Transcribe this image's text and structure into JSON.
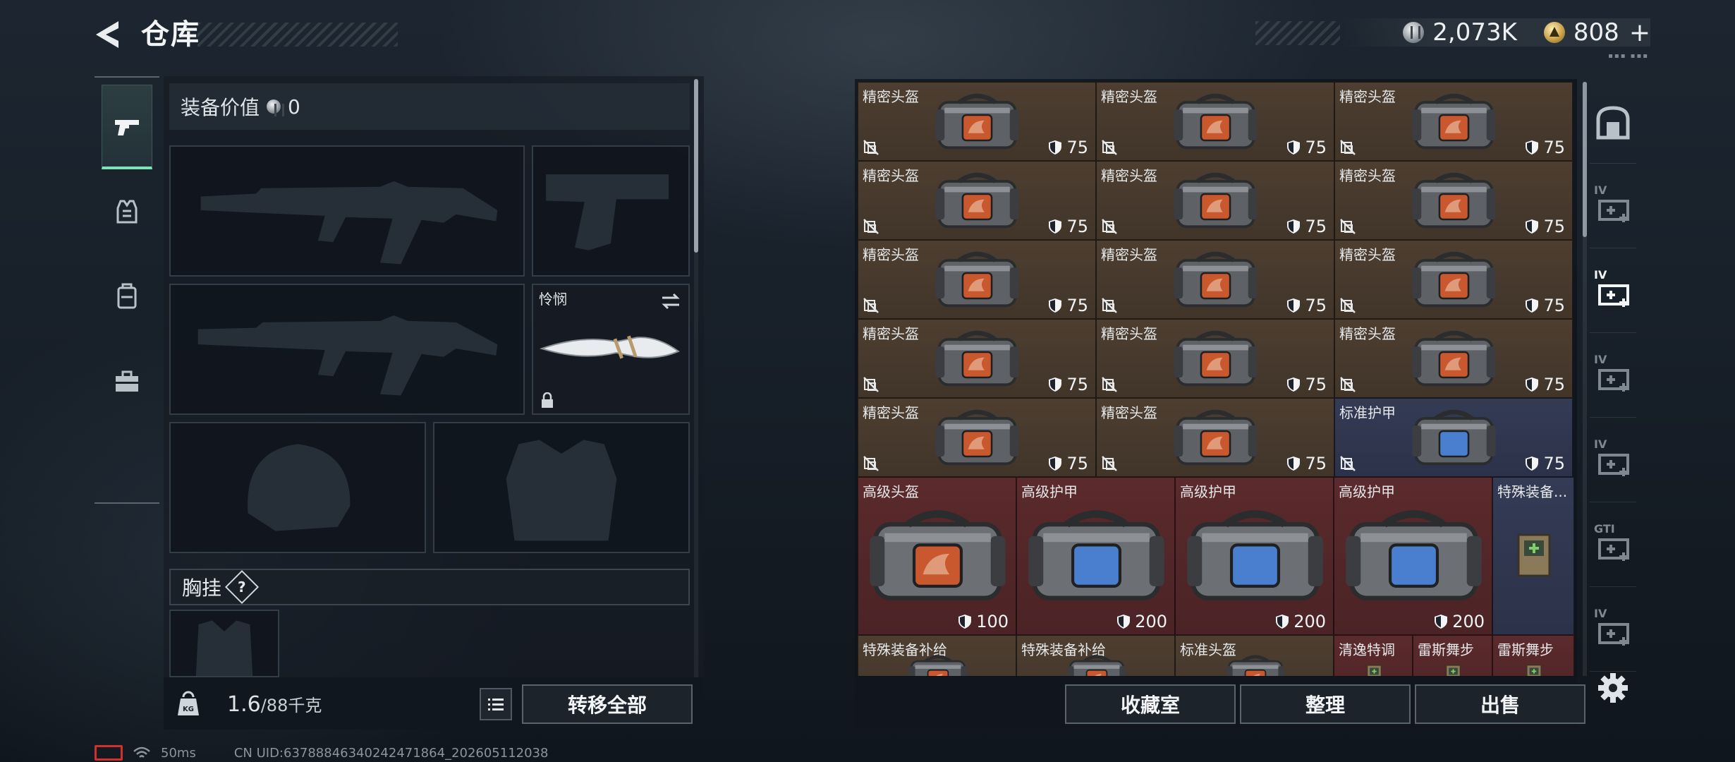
{
  "header": {
    "title": "仓库",
    "back_icon": "back-arrow-icon"
  },
  "currency": {
    "silver_amount": "2,073K",
    "silver_icon": "silver-coin-icon",
    "gold_amount": "808",
    "gold_icon": "gold-coin-icon",
    "plus_label": "+"
  },
  "rail": {
    "items": [
      {
        "icon": "pistol-icon",
        "active": true
      },
      {
        "icon": "armor-vest-icon",
        "active": false
      },
      {
        "icon": "backpack-icon",
        "active": false
      },
      {
        "icon": "toolbox-icon",
        "active": false
      }
    ]
  },
  "equipment": {
    "value_label": "装备价值",
    "value_amount": "0",
    "melee_name": "怜悯",
    "chest_label": "胸挂",
    "help_label": "?",
    "weight_current": "1.6",
    "weight_max": "/88千克",
    "transfer_all": "转移全部"
  },
  "storage": {
    "rows": [
      [
        {
          "name": "精密头盔",
          "color": "brown",
          "armor": "75",
          "locked": true
        },
        {
          "name": "精密头盔",
          "color": "brown",
          "armor": "75",
          "locked": true
        },
        {
          "name": "精密头盔",
          "color": "brown",
          "armor": "75",
          "locked": true
        }
      ],
      [
        {
          "name": "精密头盔",
          "color": "brown",
          "armor": "75",
          "locked": true
        },
        {
          "name": "精密头盔",
          "color": "brown",
          "armor": "75",
          "locked": true
        },
        {
          "name": "精密头盔",
          "color": "brown",
          "armor": "75",
          "locked": true
        }
      ],
      [
        {
          "name": "精密头盔",
          "color": "brown",
          "armor": "75",
          "locked": true
        },
        {
          "name": "精密头盔",
          "color": "brown",
          "armor": "75",
          "locked": true
        },
        {
          "name": "精密头盔",
          "color": "brown",
          "armor": "75",
          "locked": true
        }
      ],
      [
        {
          "name": "精密头盔",
          "color": "brown",
          "armor": "75",
          "locked": true
        },
        {
          "name": "精密头盔",
          "color": "brown",
          "armor": "75",
          "locked": true
        },
        {
          "name": "精密头盔",
          "color": "brown",
          "armor": "75",
          "locked": true
        }
      ],
      [
        {
          "name": "精密头盔",
          "color": "brown",
          "armor": "75",
          "locked": true
        },
        {
          "name": "精密头盔",
          "color": "brown",
          "armor": "75",
          "locked": true
        },
        {
          "name": "标准护甲",
          "color": "blue",
          "armor": "75",
          "locked": true
        }
      ]
    ],
    "large_row": [
      {
        "name": "高级头盔",
        "color": "red",
        "armor": "100",
        "emblem": "red"
      },
      {
        "name": "高级护甲",
        "color": "red",
        "armor": "200",
        "emblem": "blue"
      },
      {
        "name": "高级护甲",
        "color": "red",
        "armor": "200",
        "emblem": "blue"
      },
      {
        "name": "高级护甲",
        "color": "red",
        "armor": "200",
        "emblem": "blue"
      },
      {
        "name": "特殊装备...",
        "color": "blue",
        "armor": "",
        "emblem": "kit"
      }
    ],
    "partial_row": [
      {
        "name": "特殊装备补给",
        "color": "brown"
      },
      {
        "name": "特殊装备补给",
        "color": "brown"
      },
      {
        "name": "标准头盔",
        "color": "brown"
      },
      {
        "name": "清逸特调",
        "color": "red"
      },
      {
        "name": "雷斯舞步",
        "color": "red"
      },
      {
        "name": "雷斯舞步",
        "color": "red"
      }
    ],
    "buttons": {
      "collection": "收藏室",
      "organize": "整理",
      "sell": "出售"
    }
  },
  "side_tabs": [
    {
      "icon": "vault-icon"
    },
    {
      "icon": "folder-tab-icon",
      "label": "IV"
    },
    {
      "icon": "medkit-tab-icon",
      "label": "IV"
    },
    {
      "icon": "medkit-tab-icon",
      "label": "IV"
    },
    {
      "icon": "medkit-tab-icon",
      "label": "IV"
    },
    {
      "icon": "gti-tab-icon",
      "label": "GTI"
    },
    {
      "icon": "weapon-tab-icon",
      "label": "IV"
    }
  ],
  "status": {
    "ping": "50ms",
    "uid": "CN UID:6378884634024247186​4_202605112038"
  },
  "colors": {
    "accent_green": "#7fe3b8",
    "brown_tile": "#4d3e30",
    "blue_tile": "#343b55",
    "red_tile": "#5b2a2c",
    "battery_red": "#d0312d"
  }
}
